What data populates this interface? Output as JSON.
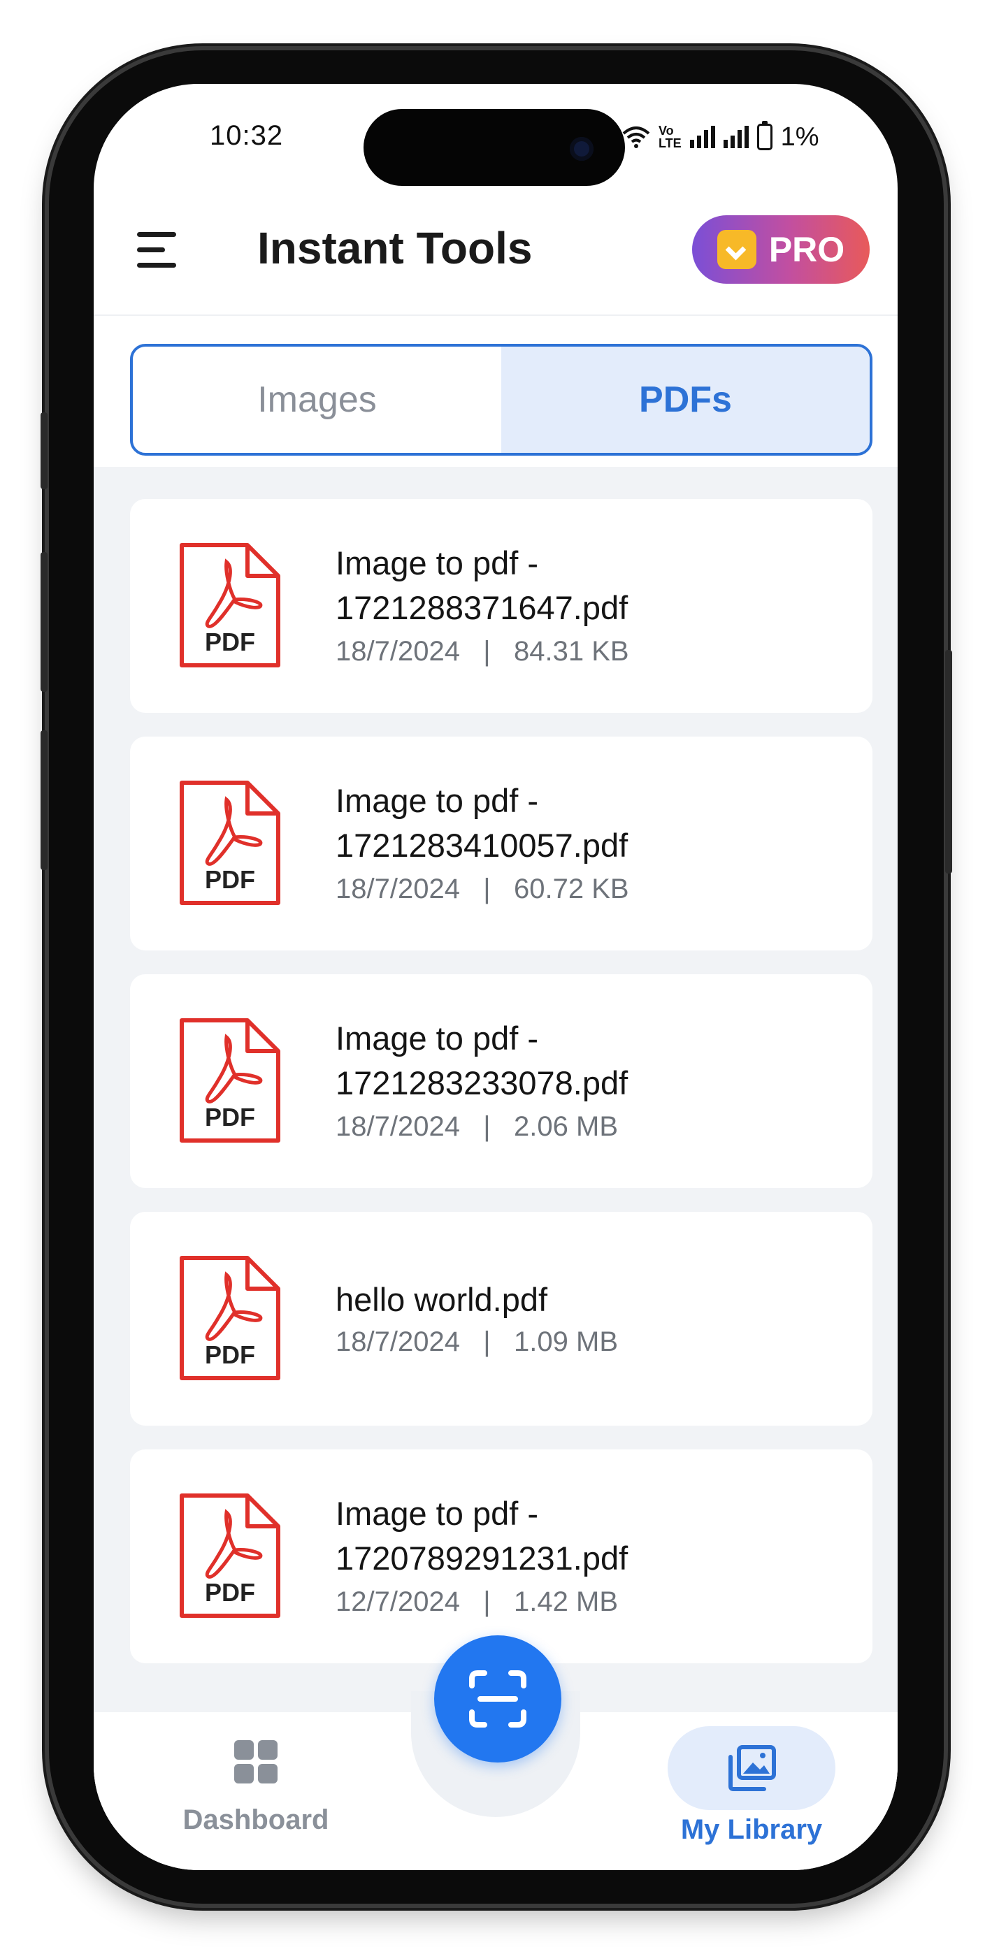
{
  "status_bar": {
    "time": "10:32",
    "carrier_text": "Vo\nLTE",
    "battery": "1%"
  },
  "header": {
    "title": "Instant Tools",
    "pro_label": "PRO"
  },
  "tabs": [
    {
      "label": "Images",
      "active": false
    },
    {
      "label": "PDFs",
      "active": true
    }
  ],
  "files": [
    {
      "name": "Image to pdf -\n1721288371647.pdf",
      "date": "18/7/2024",
      "size": "84.31 KB"
    },
    {
      "name": "Image to pdf -\n1721283410057.pdf",
      "date": "18/7/2024",
      "size": "60.72 KB"
    },
    {
      "name": "Image to pdf -\n1721283233078.pdf",
      "date": "18/7/2024",
      "size": "2.06 MB"
    },
    {
      "name": "hello world.pdf",
      "date": "18/7/2024",
      "size": "1.09 MB"
    },
    {
      "name": "Image to pdf -\n1720789291231.pdf",
      "date": "12/7/2024",
      "size": "1.42 MB"
    }
  ],
  "file_icon_label": "PDF",
  "meta_separator": "|",
  "bottom_nav": {
    "dashboard_label": "Dashboard",
    "library_label": "My Library",
    "active": "library"
  },
  "colors": {
    "accent": "#2d72d6",
    "fab": "#2277f0",
    "pdf_red": "#e0302a",
    "list_bg": "#f1f3f6"
  }
}
